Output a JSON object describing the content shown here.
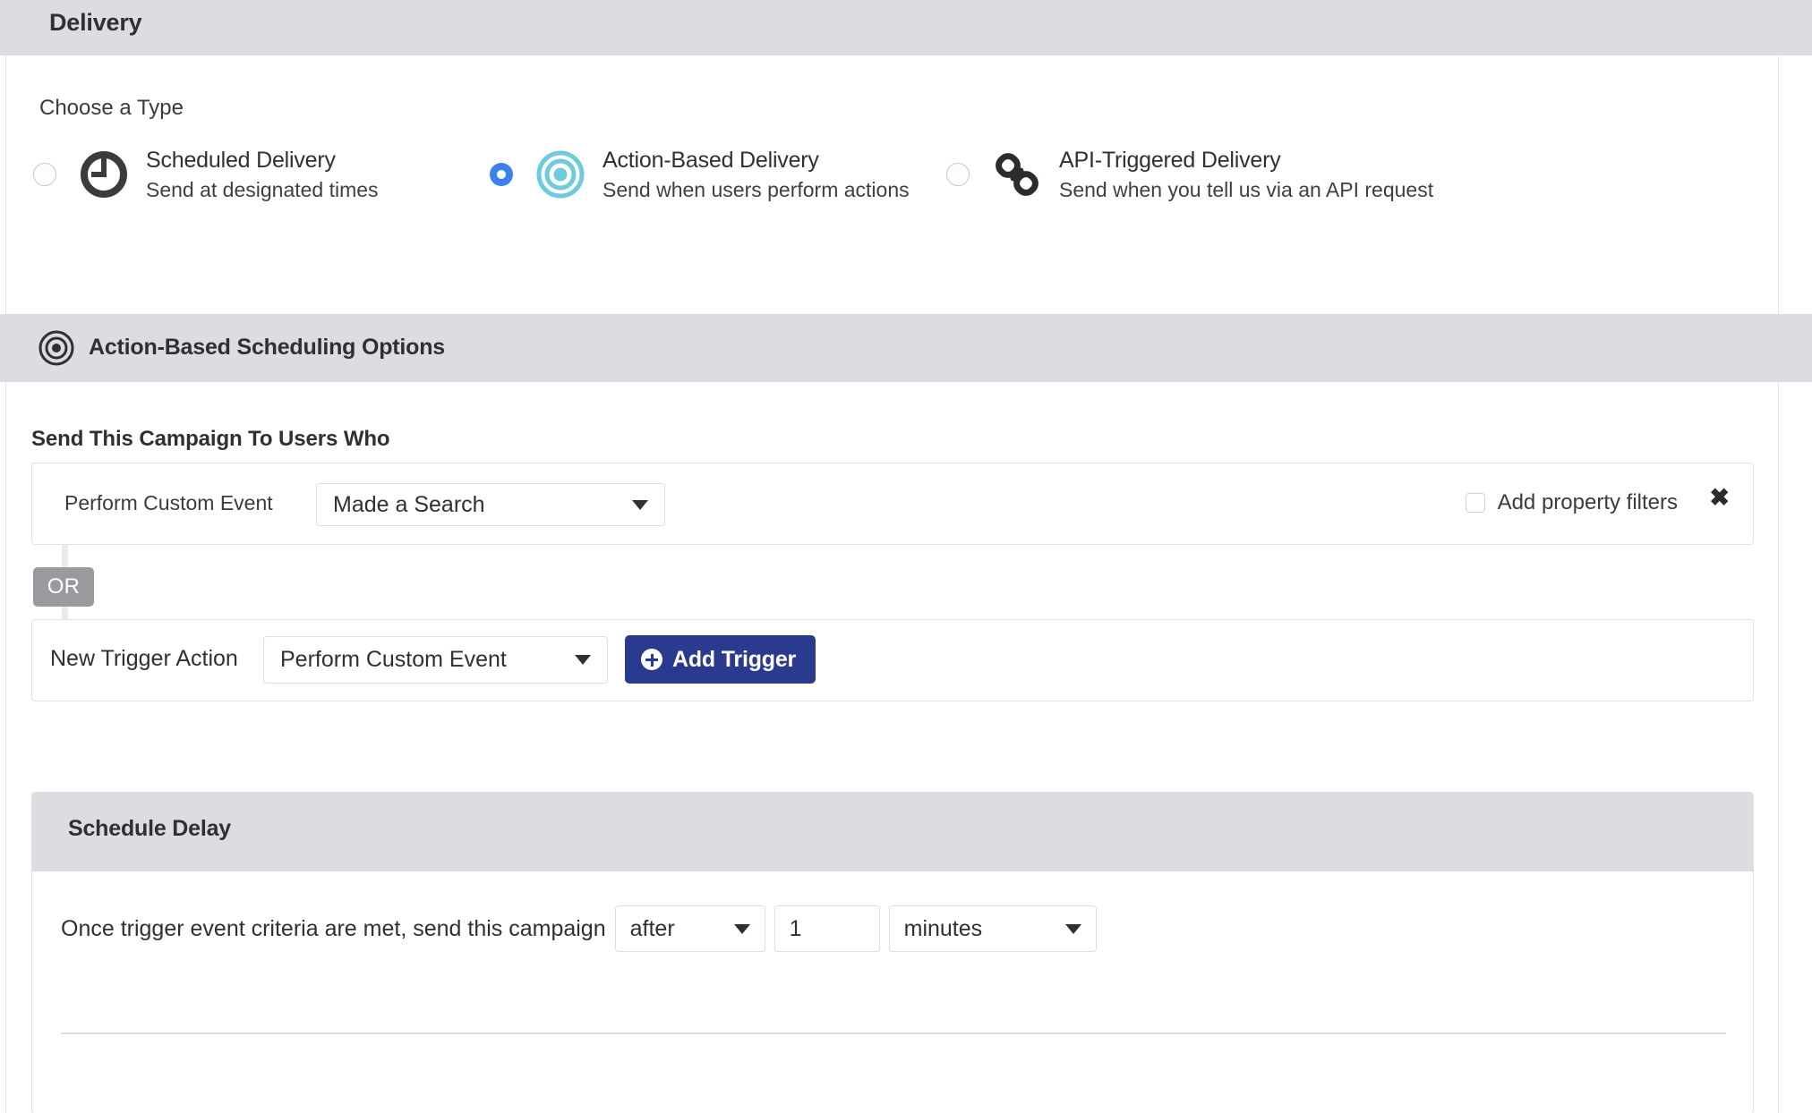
{
  "header": {
    "tab_label": "Delivery",
    "accent_color": "#2a3b8f"
  },
  "choose_type": {
    "label": "Choose a Type",
    "options": [
      {
        "title": "Scheduled Delivery",
        "subtitle": "Send at designated times",
        "icon": "clock-icon",
        "selected": false
      },
      {
        "title": "Action-Based Delivery",
        "subtitle": "Send when users perform actions",
        "icon": "target-icon",
        "selected": true
      },
      {
        "title": "API-Triggered Delivery",
        "subtitle": "Send when you tell us via an API request",
        "icon": "link-chain-icon",
        "selected": false
      }
    ]
  },
  "scheduling_section": {
    "title": "Action-Based Scheduling Options",
    "icon": "target-icon"
  },
  "triggers": {
    "heading": "Send This Campaign To Users Who",
    "existing": {
      "label": "Perform Custom Event",
      "event_value": "Made a Search",
      "property_filter_label": "Add property filters",
      "property_filter_checked": false,
      "remove_icon": "✖"
    },
    "connector_label": "OR",
    "new_trigger": {
      "label": "New Trigger Action",
      "action_value": "Perform Custom Event",
      "add_button_label": "Add Trigger"
    }
  },
  "schedule_delay": {
    "title": "Schedule Delay",
    "sentence": "Once trigger event criteria are met, send this campaign",
    "when_value": "after",
    "amount_value": "1",
    "unit_value": "minutes"
  }
}
